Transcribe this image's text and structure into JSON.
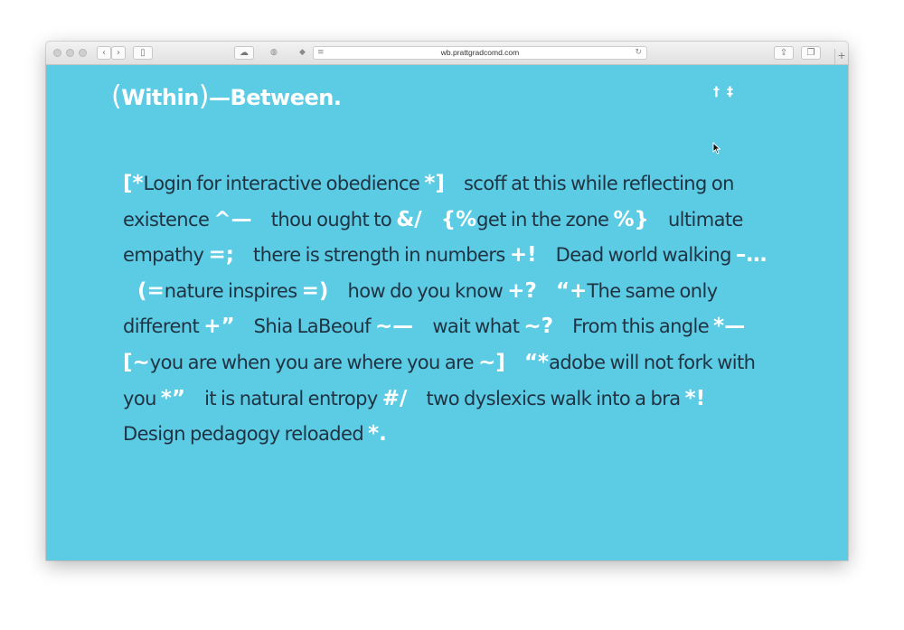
{
  "browser": {
    "url": "wb.prattgradcomd.com",
    "new_tab_symbol": "+"
  },
  "site": {
    "title_open": "(",
    "title_within": "Within",
    "title_close": ")",
    "title_rest": "—Between.",
    "nav_icon_1": "†",
    "nav_icon_2": "‡"
  },
  "colors": {
    "background": "#5ccbe4",
    "text": "#1f3342",
    "symbols": "#ffffff"
  },
  "phrases": [
    {
      "pre": "[*",
      "text": "Login for interactive obedience",
      "post": "*]"
    },
    {
      "pre": "",
      "text": "scoff at this while reflecting on existence",
      "post": "^—"
    },
    {
      "pre": "",
      "text": "thou ought to",
      "post": "&/"
    },
    {
      "pre": "{%",
      "text": "get in the zone",
      "post": "%}"
    },
    {
      "pre": "",
      "text": "ultimate empathy",
      "post": "=;"
    },
    {
      "pre": "",
      "text": "there is strength in numbers",
      "post": "+!"
    },
    {
      "pre": "",
      "text": "Dead world walking",
      "post": "–…"
    },
    {
      "pre": "(=",
      "text": "nature inspires",
      "post": "=)"
    },
    {
      "pre": "",
      "text": "how do you know",
      "post": "+?"
    },
    {
      "pre": "“+",
      "text": "The same only different",
      "post": "+”"
    },
    {
      "pre": "",
      "text": "Shia LaBeouf",
      "post": "~—"
    },
    {
      "pre": "",
      "text": "wait what",
      "post": "~?"
    },
    {
      "pre": "",
      "text": "From this angle",
      "post": "*—"
    },
    {
      "pre": "[~",
      "text": "you are when you are where you are",
      "post": "~]"
    },
    {
      "pre": "“*",
      "text": "adobe will not fork with you",
      "post": "*”"
    },
    {
      "pre": "",
      "text": "it is natural entropy",
      "post": "#/"
    },
    {
      "pre": "",
      "text": "two dyslexics walk into a bra",
      "post": "*!"
    },
    {
      "pre": "",
      "text": "Design pedagogy reloaded",
      "post": "*."
    }
  ]
}
